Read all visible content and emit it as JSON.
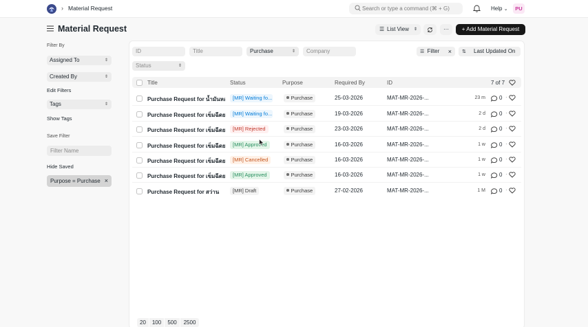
{
  "navbar": {
    "breadcrumb": "Material Request",
    "search_placeholder": "Search or type a command (⌘ + G)",
    "help_label": "Help",
    "avatar_initials": "PU"
  },
  "page": {
    "title": "Material Request",
    "list_view_label": "List View",
    "more_label": "···",
    "add_button_label": "+ Add Material Request"
  },
  "sidebar": {
    "filter_by_label": "Filter By",
    "assigned_to": "Assigned To",
    "created_by": "Created By",
    "edit_filters": "Edit Filters",
    "tags": "Tags",
    "show_tags": "Show Tags",
    "save_filter_label": "Save Filter",
    "filter_name_placeholder": "Filter Name",
    "hide_saved": "Hide Saved",
    "saved_chip": "Purpose = Purchase"
  },
  "filters": {
    "id_placeholder": "ID",
    "title_placeholder": "Title",
    "purpose_value": "Purchase",
    "company_placeholder": "Company",
    "status_placeholder": "Status",
    "filter_label": "Filter",
    "sort_label": "Last Updated On"
  },
  "table": {
    "headers": {
      "title": "Title",
      "status": "Status",
      "purpose": "Purpose",
      "required_by": "Required By",
      "id": "ID",
      "count": "7 of 7"
    },
    "rows": [
      {
        "title": "Purchase Request for น้ำมันหอ",
        "status": "[MR] Waiting fo...",
        "status_color": "blue",
        "purpose": "Purchase",
        "required_by": "25-03-2026",
        "id": "MAT-MR-2026-...",
        "modified": "23 m",
        "comments": "0"
      },
      {
        "title": "Purchase Request for เข็มฉีดยา",
        "status": "[MR] Waiting fo...",
        "status_color": "blue",
        "purpose": "Purchase",
        "required_by": "19-03-2026",
        "id": "MAT-MR-2026-...",
        "modified": "2 d",
        "comments": "0"
      },
      {
        "title": "Purchase Request for เข็มฉีดยา",
        "status": "[MR] Rejected",
        "status_color": "red",
        "purpose": "Purchase",
        "required_by": "23-03-2026",
        "id": "MAT-MR-2026-...",
        "modified": "2 d",
        "comments": "0"
      },
      {
        "title": "Purchase Request for เข็มฉีดยา",
        "status": "[MR] Approved",
        "status_color": "green",
        "purpose": "Purchase",
        "required_by": "16-03-2026",
        "id": "MAT-MR-2026-...",
        "modified": "1 w",
        "comments": "0"
      },
      {
        "title": "Purchase Request for เข็มฉีดยา",
        "status": "[MR] Cancelled",
        "status_color": "orange",
        "purpose": "Purchase",
        "required_by": "16-03-2026",
        "id": "MAT-MR-2026-...",
        "modified": "1 w",
        "comments": "0"
      },
      {
        "title": "Purchase Request for เข็มฉีดยา",
        "status": "[MR] Approved",
        "status_color": "green",
        "purpose": "Purchase",
        "required_by": "16-03-2026",
        "id": "MAT-MR-2026-...",
        "modified": "1 w",
        "comments": "0"
      },
      {
        "title": "Purchase Request for สว่าน",
        "status": "[MR] Draft",
        "status_color": "grey",
        "purpose": "Purchase",
        "required_by": "27-02-2026",
        "id": "MAT-MR-2026-...",
        "modified": "1 M",
        "comments": "0"
      }
    ]
  },
  "paging": [
    "20",
    "100",
    "500",
    "2500"
  ]
}
